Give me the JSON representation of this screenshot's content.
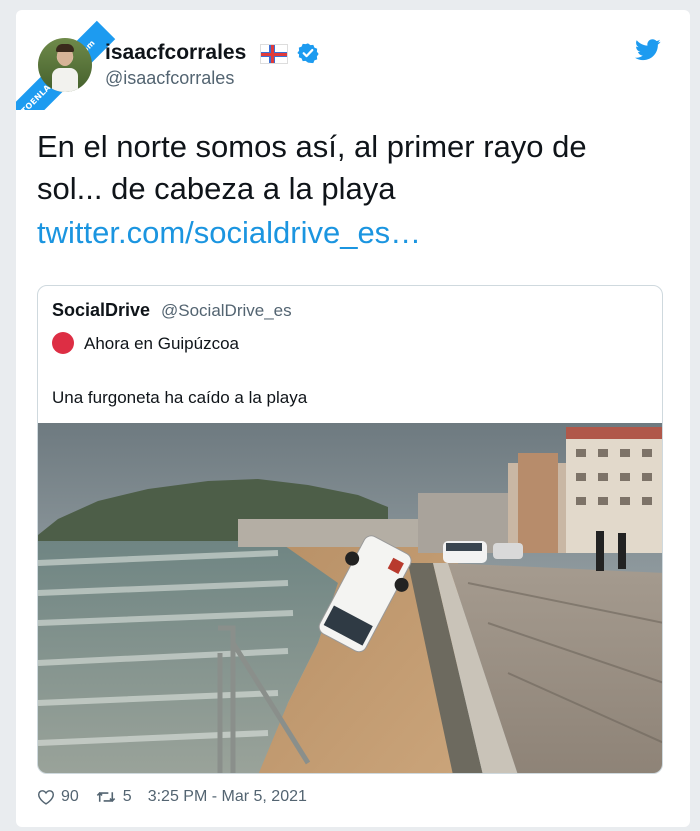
{
  "watermark": "VISTOENLASREDES .com",
  "tweet": {
    "display_name": "isaacfcorrales",
    "handle": "@isaacfcorrales",
    "text": "En el norte somos así, al primer rayo de sol... de cabeza a la playa",
    "link": "twitter.com/socialdrive_es…",
    "likes": "90",
    "retweets": "5",
    "timestamp": "3:25 PM - Mar 5, 2021"
  },
  "quoted": {
    "display_name": "SocialDrive",
    "handle": "@SocialDrive_es",
    "location_line": "Ahora en Guipúzcoa",
    "text": "Una furgoneta ha caído a la playa"
  },
  "colors": {
    "link": "#1b95e0",
    "verified": "#1d9bf0",
    "red_dot": "#dd2e44",
    "muted": "#536471"
  },
  "icons": [
    "verified-badge-icon",
    "twitter-bird-icon",
    "heart-icon",
    "retweet-icon",
    "flag-icon",
    "red-circle-icon"
  ]
}
